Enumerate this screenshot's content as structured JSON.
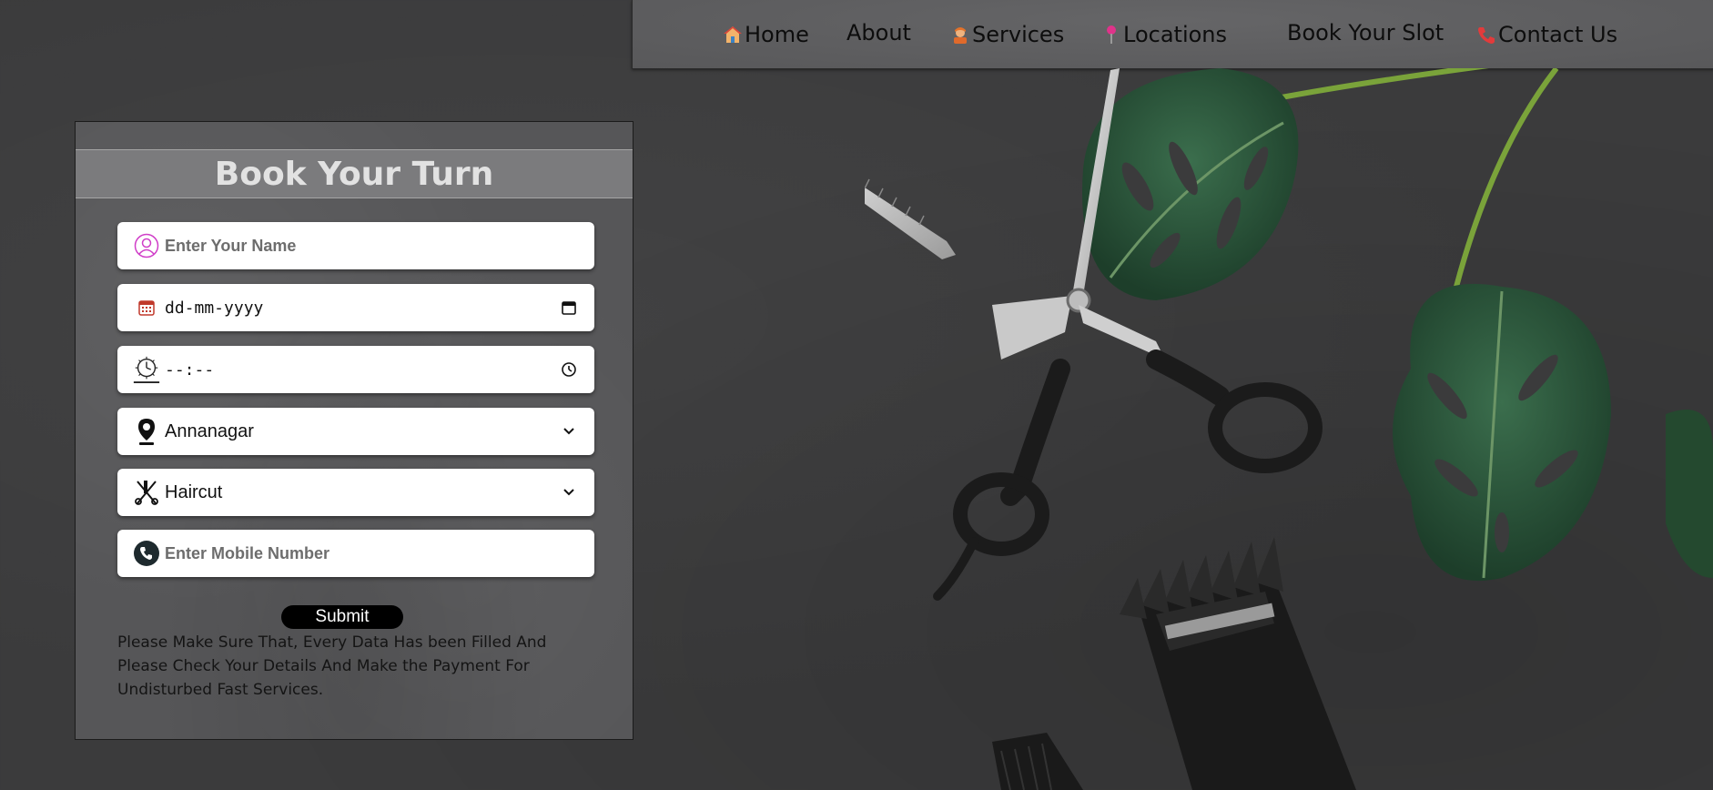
{
  "nav": {
    "items": [
      {
        "label": "Home",
        "icon": "house-icon"
      },
      {
        "label": "About",
        "icon": ""
      },
      {
        "label": "Services",
        "icon": "barber-icon"
      },
      {
        "label": "Locations",
        "icon": "pushpin-icon"
      },
      {
        "label": "Book Your Slot",
        "icon": ""
      },
      {
        "label": "Contact Us",
        "icon": "phone-icon"
      }
    ]
  },
  "form": {
    "title": "Book Your Turn",
    "name_placeholder": "Enter Your Name",
    "date_placeholder": "dd-mm-yyyy",
    "time_placeholder": "--:--",
    "location_value": "Annanagar",
    "service_value": "Haircut",
    "mobile_placeholder": "Enter Mobile Number",
    "submit_label": "Submit",
    "note": "Please Make Sure That, Every Data Has been Filled And Please Check Your Details And Make the Payment For Undisturbed Fast Services."
  },
  "colors": {
    "background": "#3b3b3c",
    "card": "#565658",
    "title_bar": "#7b7b7d",
    "leaf_green": "#2f5a3f"
  }
}
